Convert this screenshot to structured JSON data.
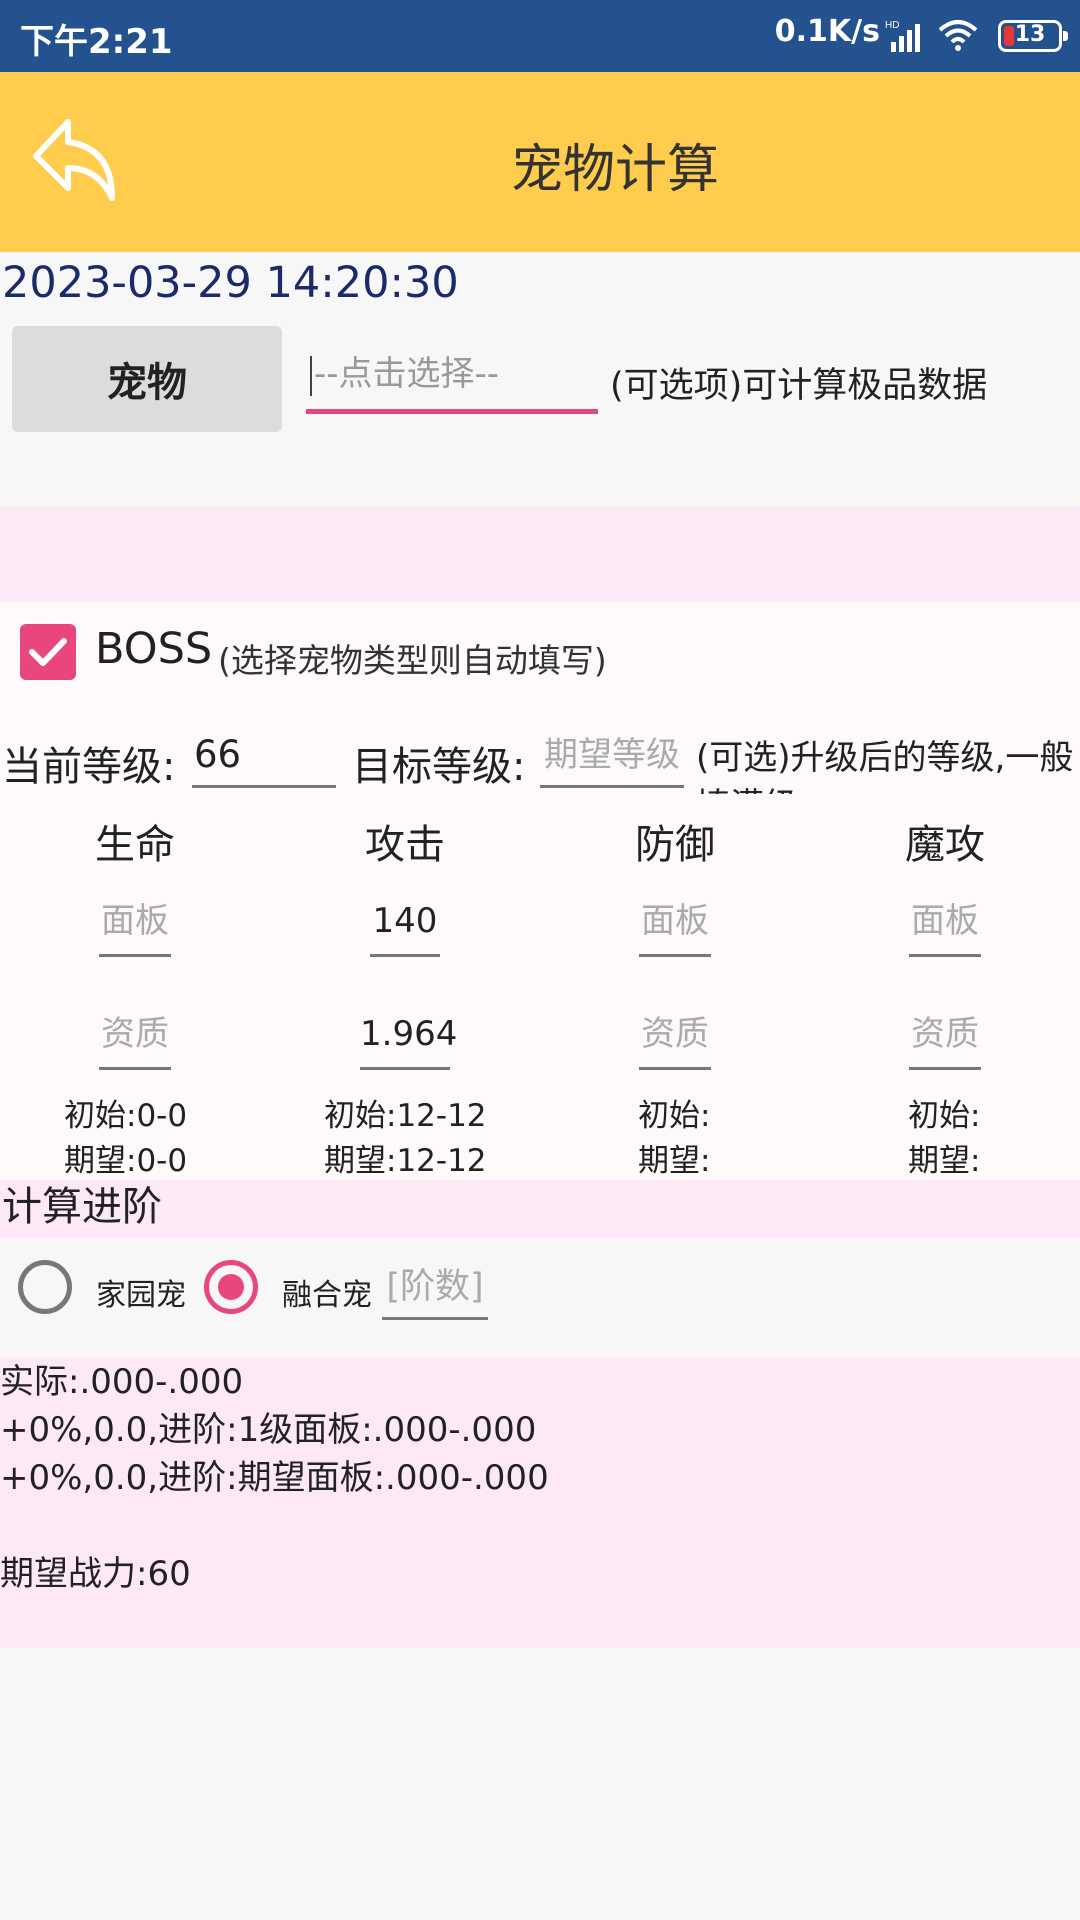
{
  "status_bar": {
    "time": "下午2:21",
    "network_speed": "0.1K/s",
    "battery_level": "13"
  },
  "app_bar": {
    "title": "宠物计算",
    "back_icon": "back-arrow-icon"
  },
  "datetime": "2023-03-29 14:20:30",
  "pet": {
    "button_label": "宠物",
    "select_placeholder": "--点击选择--",
    "note": "(可选项)可计算极品数据"
  },
  "boss": {
    "checked": true,
    "label": "BOSS",
    "note": "(选择宠物类型则自动填写)"
  },
  "level": {
    "current_label": "当前等级:",
    "current_value": "66",
    "target_label": "目标等级:",
    "target_placeholder": "期望等级",
    "target_note": "(可选)升级后的等级,一般填满级"
  },
  "stats": [
    {
      "name": "生命",
      "panel": "面板",
      "quality": "资质",
      "panel_filled": false,
      "quality_filled": false,
      "initial": "初始:0-0",
      "expected": "期望:0-0"
    },
    {
      "name": "攻击",
      "panel": "140",
      "quality": "1.964",
      "panel_filled": true,
      "quality_filled": true,
      "initial": "初始:12-12",
      "expected": "期望:12-12"
    },
    {
      "name": "防御",
      "panel": "面板",
      "quality": "资质",
      "panel_filled": false,
      "quality_filled": false,
      "initial": "初始:",
      "expected": "期望:"
    },
    {
      "name": "魔攻",
      "panel": "面板",
      "quality": "资质",
      "panel_filled": false,
      "quality_filled": false,
      "initial": "初始:",
      "expected": "期望:"
    }
  ],
  "advance": {
    "title": "计算进阶",
    "options": [
      {
        "label": "家园宠",
        "selected": false
      },
      {
        "label": "融合宠",
        "selected": true
      }
    ],
    "stage_placeholder": "[阶数]"
  },
  "results": {
    "line1": "实际:.000-.000",
    "line2": "+0%,0.0,进阶:1级面板:.000-.000",
    "line3": "+0%,0.0,进阶:期望面板:.000-.000",
    "line4": "",
    "line5": "期望战力:60"
  },
  "colors": {
    "status_bar": "#24528f",
    "app_bar": "#ffcc4d",
    "accent": "#e8467c",
    "pink_band": "#fde8f6"
  }
}
